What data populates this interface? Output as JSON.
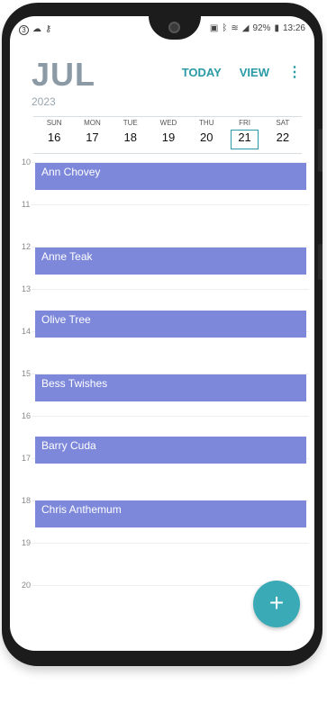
{
  "status_bar": {
    "notification_badge": "3",
    "battery": "92%",
    "time": "13:26",
    "icons": [
      "notification-circle-icon",
      "cloud-icon",
      "key-icon",
      "lock-icon",
      "bluetooth-icon",
      "wifi-icon",
      "signal-icon",
      "battery-icon"
    ]
  },
  "header": {
    "month": "JUL",
    "year": "2023",
    "today_label": "TODAY",
    "view_label": "VIEW",
    "more_icon": "more-vert-icon"
  },
  "week": {
    "days": [
      {
        "label": "SUN",
        "num": "16"
      },
      {
        "label": "MON",
        "num": "17"
      },
      {
        "label": "TUE",
        "num": "18"
      },
      {
        "label": "WED",
        "num": "19"
      },
      {
        "label": "THU",
        "num": "20"
      },
      {
        "label": "FRI",
        "num": "21"
      },
      {
        "label": "SAT",
        "num": "22"
      }
    ],
    "selected_day": "21"
  },
  "timeline": {
    "hours": [
      "10",
      "11",
      "12",
      "13",
      "14",
      "15",
      "16",
      "17",
      "18",
      "19",
      "20"
    ]
  },
  "events": [
    {
      "title": "Ann Chovey",
      "hour": "10"
    },
    {
      "title": "Anne Teak",
      "hour": "12"
    },
    {
      "title": "Olive Tree",
      "hour": "14"
    },
    {
      "title": "Bess Twishes",
      "hour": "15"
    },
    {
      "title": "Barry Cuda",
      "hour": "17"
    },
    {
      "title": "Chris Anthemum",
      "hour": "18"
    }
  ],
  "fab": {
    "icon": "plus-icon",
    "symbol": "+"
  },
  "colors": {
    "accent": "#2a9aa6",
    "event": "#7d88da",
    "fab": "#3aaab7"
  }
}
